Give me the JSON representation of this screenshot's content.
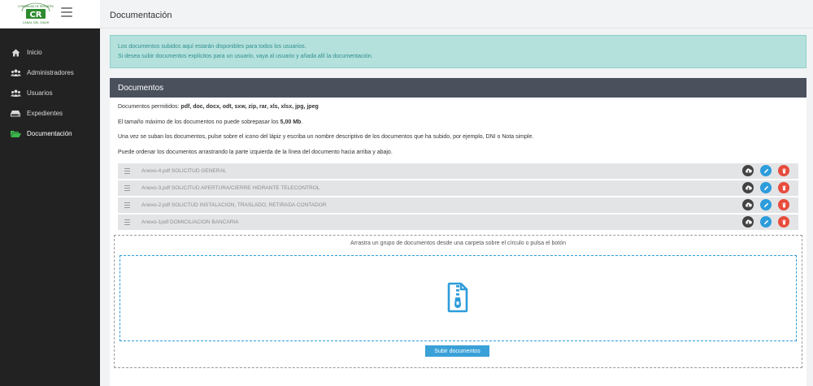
{
  "logo": {
    "top_text": "COMUNIDAD DE REGANTES",
    "monogram": "CR",
    "bottom_text": "CANAL DEL ZUJAR"
  },
  "header": {
    "title": "Documentación"
  },
  "sidebar": {
    "items": [
      {
        "label": "Inicio",
        "icon": "home-icon"
      },
      {
        "label": "Administradores",
        "icon": "users-icon"
      },
      {
        "label": "Usuarios",
        "icon": "users-icon"
      },
      {
        "label": "Expedientes",
        "icon": "hdd-icon"
      },
      {
        "label": "Documentación",
        "icon": "folder-open-icon",
        "active": true
      }
    ]
  },
  "alert": {
    "line1": "Los documentos subidos aquí estarán disponibles para todos los usuarios.",
    "line2": "Si desea subir documentos explícitos para un usuario, vaya al usuario y añada allí la documentación."
  },
  "panel": {
    "title": "Documentos",
    "allowed_prefix": "Documentos permitidos: ",
    "allowed_types": "pdf, doc, docx, odt, sxw, zip, rar, xls, xlsx, jpg, jpeg",
    "maxsize_prefix": "El tamaño máximo de los documentos no puede sobrepasar los ",
    "maxsize_value": "5,00 Mb",
    "maxsize_suffix": ".",
    "instructions": "Una vez se suban los documentos, pulse sobre el icono del lápiz y escriba un nombre descriptivo de los documentos que ha subido, por ejemplo, DNI o Nota simple.",
    "reorder_hint": "Puede ordenar los documentos arrastrando la parte izquierda de la línea del documento hacia arriba y abajo."
  },
  "documents": [
    {
      "name": "Anexo-4.pdf SOLICITUD GENERAL"
    },
    {
      "name": "Anexo-3.pdf SOLICITUD APERTURA/CIERRE HIDRANTE TELECONTROL"
    },
    {
      "name": "Anexo-2.pdf SOLICTUD INSTALACION, TRASLADO, RETIRADA CONTADOR"
    },
    {
      "name": "Anexo-1pdf DOMICILIACION BANCARIA"
    }
  ],
  "upload": {
    "hint": "Arrastra un grupo de documentos desde una carpeta sobre el círculo o pulsa el botón",
    "button_label": "Subir documentos"
  },
  "colors": {
    "sidebar_bg": "#222222",
    "panel_header": "#4a505c",
    "alert_bg": "#b4e1dc",
    "alert_text": "#2f8f8f",
    "download": "#434343",
    "edit": "#2d9cdb",
    "delete": "#e74c3c",
    "active_icon": "#3bb54a"
  }
}
